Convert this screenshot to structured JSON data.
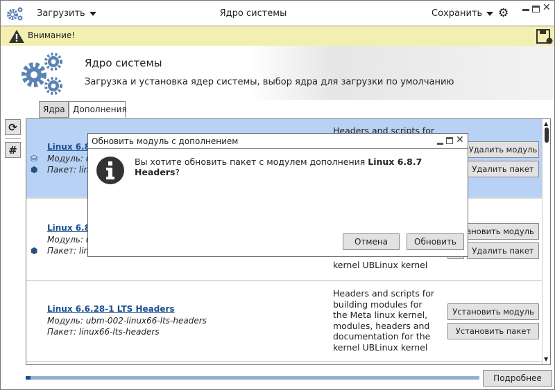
{
  "titlebar": {
    "title": "Ядро системы",
    "load_menu": "Загрузить",
    "save_menu": "Сохранить"
  },
  "warning": {
    "text": "Внимание!"
  },
  "banner": {
    "title": "Ядро системы",
    "subtitle": "Загрузка и установка ядер системы, выбор ядра для загрузки по умолчанию"
  },
  "tabs": [
    {
      "label": "Ядра",
      "active": false
    },
    {
      "label": "Дополнения",
      "active": true
    }
  ],
  "list": {
    "rows": [
      {
        "title": "Linux 6.8.",
        "module": "Модуль: u",
        "package": "Пакет: linu",
        "description": "Headers and scripts for",
        "buttons": [
          "Удалить модуль",
          "Удалить пакет"
        ],
        "selected": true
      },
      {
        "title": "Linux 6.8.",
        "module": "Модуль: u",
        "package": "Пакет: lin",
        "description": "documentation for the\nkernel UBLinux kernel",
        "buttons": [
          "Установить модуль",
          "Удалить пакет"
        ],
        "selected": false
      },
      {
        "title": "Linux 6.6.28-1 LTS Headers",
        "module": "Модуль: ubm-002-linux66-lts-headers",
        "package": "Пакет: linux66-lts-headers",
        "description": "Headers and scripts for building modules for the Meta linux kernel, modules, headers and documentation for the kernel UBLinux kernel",
        "buttons": [
          "Установить модуль",
          "Установить пакет"
        ],
        "selected": false
      }
    ]
  },
  "progress": {
    "percent": 1
  },
  "details_button": "Подробнее",
  "dialog": {
    "title": "Обновить модуль с дополнением",
    "message": "Вы хотите обновить пакет с модулем дополнения ",
    "message_bold": "Linux 6.8.7 Headers",
    "message_end": "?",
    "cancel": "Отмена",
    "confirm": "Обновить"
  },
  "colors": {
    "accent": "#5b82b4",
    "selected_row": "#b7d2f5",
    "warning_bg": "#f3efb0",
    "link": "#1a4f8f"
  }
}
